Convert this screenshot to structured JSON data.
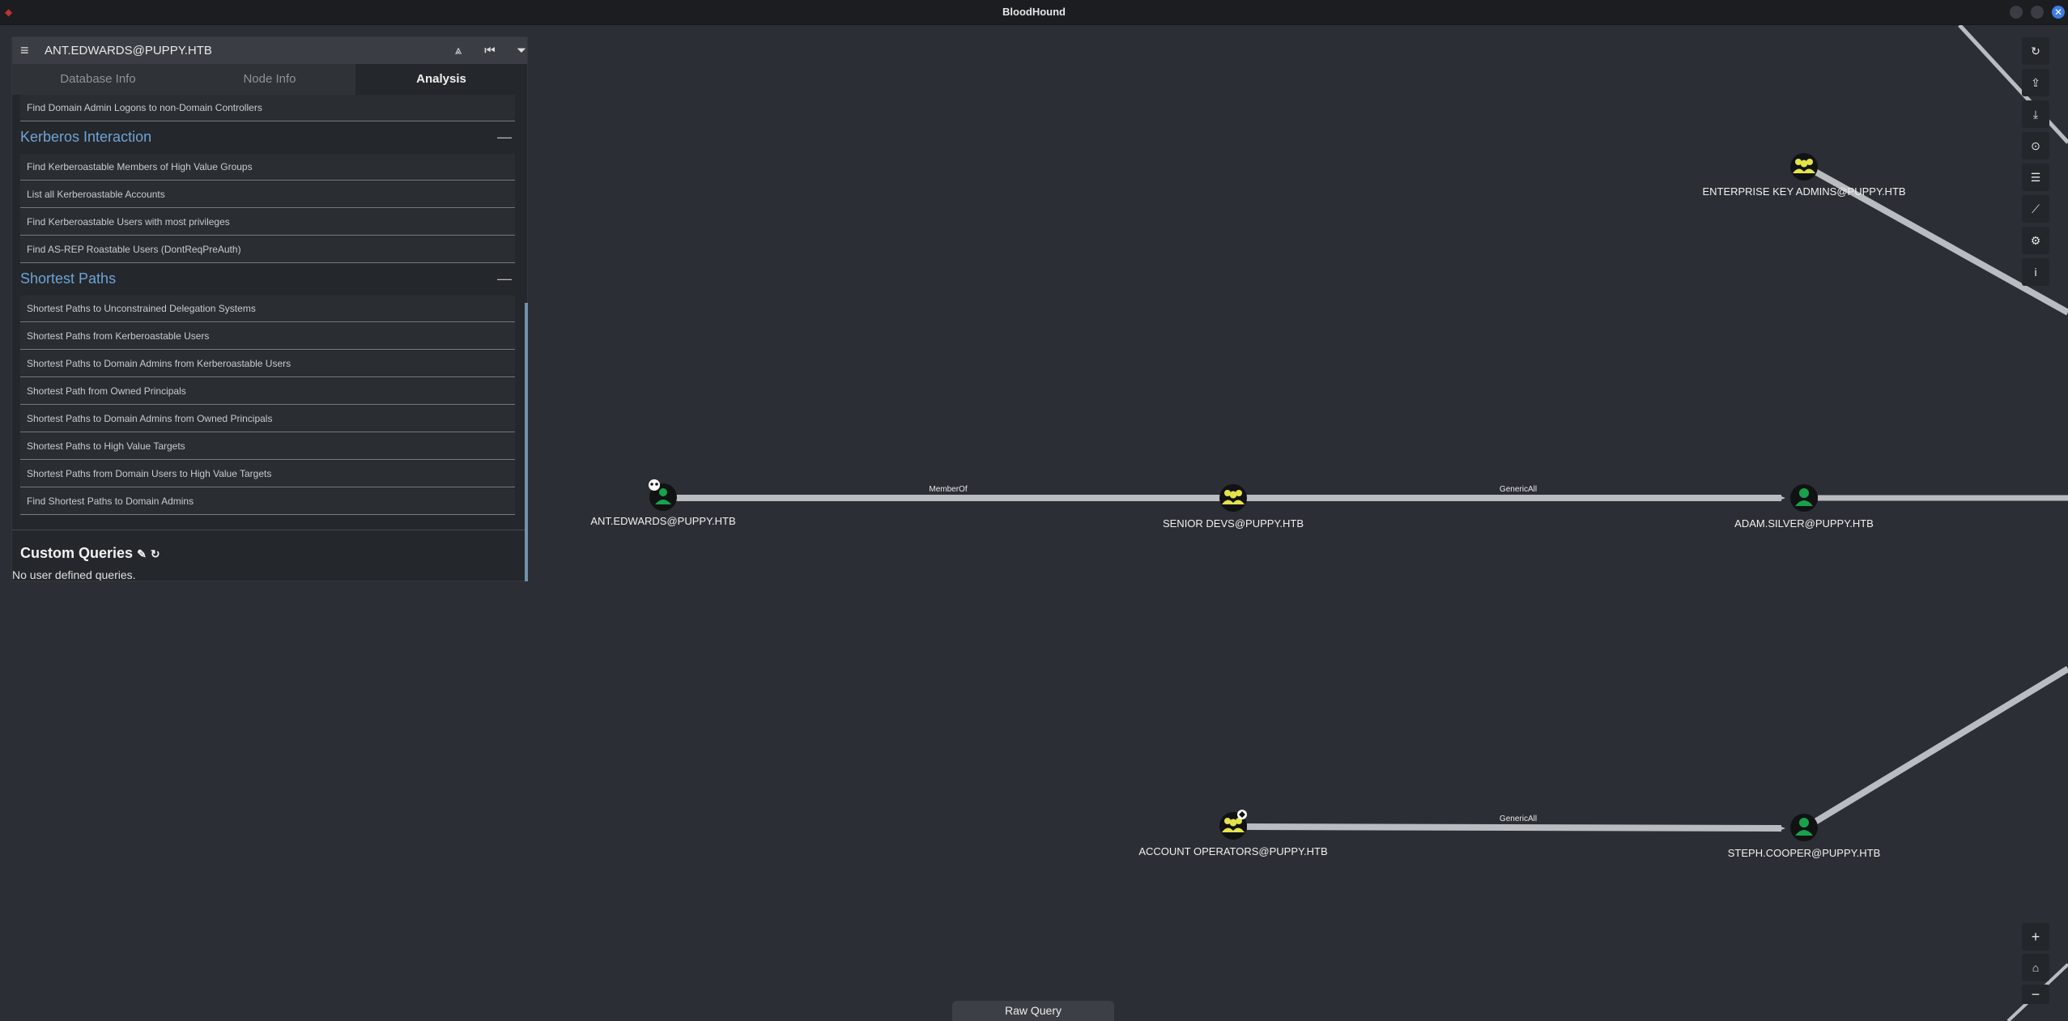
{
  "window": {
    "title": "BloodHound"
  },
  "search": {
    "value": "ANT.EDWARDS@PUPPY.HTB"
  },
  "tabs": [
    {
      "label": "Database Info"
    },
    {
      "label": "Node Info"
    },
    {
      "label": "Analysis"
    }
  ],
  "analysis": {
    "top_item": "Find Domain Admin Logons to non-Domain Controllers",
    "kerberos": {
      "title": "Kerberos Interaction",
      "items": [
        "Find Kerberoastable Members of High Value Groups",
        "List all Kerberoastable Accounts",
        "Find Kerberoastable Users with most privileges",
        "Find AS-REP Roastable Users (DontReqPreAuth)"
      ]
    },
    "shortest": {
      "title": "Shortest Paths",
      "items": [
        "Shortest Paths to Unconstrained Delegation Systems",
        "Shortest Paths from Kerberoastable Users",
        "Shortest Paths to Domain Admins from Kerberoastable Users",
        "Shortest Path from Owned Principals",
        "Shortest Paths to Domain Admins from Owned Principals",
        "Shortest Paths to High Value Targets",
        "Shortest Paths from Domain Users to High Value Targets",
        "Find Shortest Paths to Domain Admins"
      ]
    },
    "custom": {
      "title": "Custom Queries",
      "empty_text": "No user defined queries."
    }
  },
  "graph": {
    "nodes": [
      {
        "id": "ant",
        "label": "ANT.EDWARDS@PUPPY.HTB",
        "type": "user",
        "owned": true
      },
      {
        "id": "senior",
        "label": "SENIOR DEVS@PUPPY.HTB",
        "type": "group"
      },
      {
        "id": "adam",
        "label": "ADAM.SILVER@PUPPY.HTB",
        "type": "user"
      },
      {
        "id": "eka",
        "label": "ENTERPRISE KEY ADMINS@PUPPY.HTB",
        "type": "group"
      },
      {
        "id": "accops",
        "label": "ACCOUNT OPERATORS@PUPPY.HTB",
        "type": "group",
        "high_value": true
      },
      {
        "id": "steph",
        "label": "STEPH.COOPER@PUPPY.HTB",
        "type": "user"
      }
    ],
    "edges": [
      {
        "from": "ant",
        "to": "senior",
        "label": "MemberOf"
      },
      {
        "from": "senior",
        "to": "adam",
        "label": "GenericAll"
      },
      {
        "from": "accops",
        "to": "steph",
        "label": "GenericAll"
      }
    ]
  },
  "right_toolbar": [
    "refresh-icon",
    "upload-icon",
    "download-icon",
    "export-icon",
    "list-icon",
    "chart-icon",
    "settings-icon",
    "info-icon"
  ],
  "zoom_controls": {
    "zoom_in": "+",
    "home": "⌂",
    "zoom_out": "−"
  },
  "raw_query": {
    "label": "Raw Query"
  },
  "colors": {
    "user": "#17a34a",
    "group": "#e4e44a",
    "node_bg": "#111214",
    "edge": "#b9bcc0"
  }
}
